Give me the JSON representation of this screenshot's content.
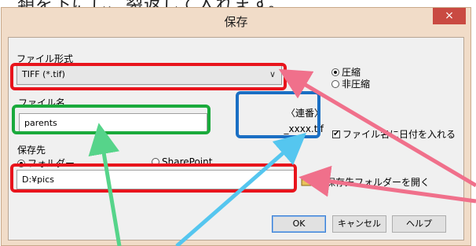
{
  "document": {
    "text": "類を下にし、裂返して入れます。"
  },
  "window": {
    "title": "保存",
    "close_glyph": "×"
  },
  "format": {
    "label": "ファイル形式",
    "selected": "TIFF (*.tif)",
    "compression": [
      "圧縮",
      "非圧縮"
    ],
    "compression_selected": "圧縮"
  },
  "filename": {
    "label": "ファイル名",
    "value": "parents",
    "sequence_line1": "〈連番〉",
    "sequence_line2": "_xxxx.tif",
    "date_checkbox_label": "ファイル名に日付を入れる",
    "date_checked": true
  },
  "destination": {
    "label": "保存先",
    "options": [
      "フォルダー",
      "SharePoint"
    ],
    "selected": "フォルダー",
    "path": "D:¥pics",
    "open_folder_label": "保存先フォルダーを開く",
    "open_folder_checked": true
  },
  "buttons": {
    "ok": "OK",
    "cancel": "キャンセル",
    "help": "ヘルプ"
  },
  "colors": {
    "highlight_red": "#e8141c",
    "highlight_green": "#1aaa3c",
    "highlight_blue": "#1b6fc4",
    "arrow_green": "#56d48a",
    "arrow_blue": "#55c6ef",
    "arrow_red": "#f0708b"
  }
}
